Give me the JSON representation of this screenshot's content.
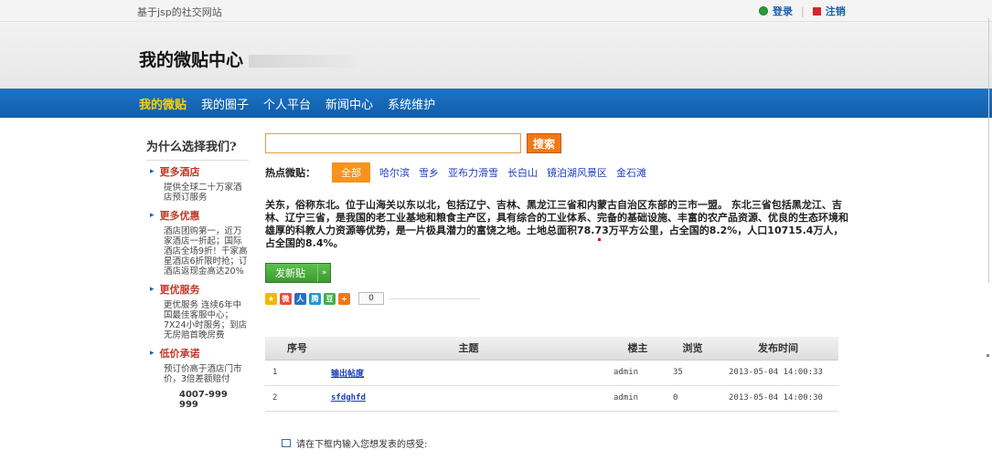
{
  "topbar": {
    "site_name": "基于jsp的社交网站",
    "login": "登录",
    "logout": "注销"
  },
  "header": {
    "title": "我的微贴中心"
  },
  "nav": {
    "items": [
      "我的微贴",
      "我的圈子",
      "个人平台",
      "新闻中心",
      "系统维护"
    ],
    "active_index": 0
  },
  "sidebar": {
    "heading": "为什么选择我们?",
    "sections": [
      {
        "label": "更多酒店",
        "desc": "提供全球二十万家酒店预订服务"
      },
      {
        "label": "更多优惠",
        "desc": "酒店团购第一，近万家酒店一折起；国际酒店全场9折！千家高星酒店6折限时抢；订酒店返现金高达20%"
      },
      {
        "label": "更优服务",
        "desc": "更优服务 连续6年中国最佳客服中心；7X24小时服务；到店无房赔首晚房费"
      },
      {
        "label": "低价承诺",
        "desc": "预订价高于酒店门市价，3倍差额赔付"
      }
    ],
    "phone": "4007-999 999"
  },
  "search": {
    "button": "搜索",
    "placeholder": ""
  },
  "hot": {
    "label": "热点微贴：",
    "all": "全部",
    "tags": [
      "哈尔滨",
      "雪乡",
      "亚布力滑雪",
      "长白山",
      "镜泊湖风景区",
      "金石滩"
    ]
  },
  "intro": "关东，俗称东北。位于山海关以东以北，包括辽宁、吉林、黑龙江三省和内蒙古自治区东部的三市一盟。 东北三省包括黑龙江、吉林、辽宁三省，是我国的老工业基地和粮食主产区，具有综合的工业体系、完备的基础设施、丰富的农产品资源、优良的生态环境和雄厚的科教人力资源等优势，是一片极具潜力的富饶之地。土地总面积78.73万平方公里，占全国的8.2%，人口10715.4万人，占全国的8.4%。",
  "post_button": "发新贴",
  "share": {
    "count": "0"
  },
  "table": {
    "headers": [
      "序号",
      "主题",
      "楼主",
      "浏览",
      "发布时间"
    ],
    "rows": [
      {
        "no": "1",
        "topic": "输出帖度",
        "owner": "admin",
        "views": "35",
        "time": "2013-05-04 14:00:33"
      },
      {
        "no": "2",
        "topic": "sfdghfd",
        "owner": "admin",
        "views": "0",
        "time": "2013-05-04 14:00:30"
      }
    ]
  },
  "comment_prompt": "请在下框内输入您想发表的感受:"
}
